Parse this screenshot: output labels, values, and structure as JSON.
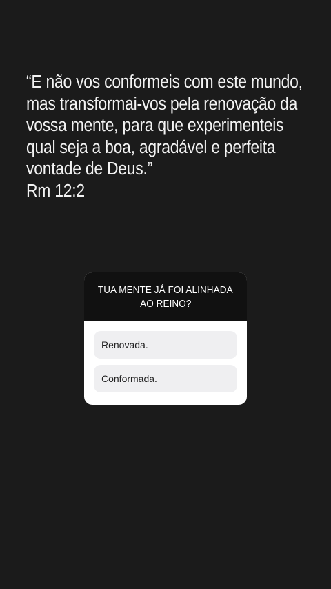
{
  "story": {
    "quote_lines": [
      "“E não vos conformeis com este mundo,",
      "mas transformai-vos pela renovação da",
      "vossa mente, para que experimenteis",
      "qual seja a boa, agradável e perfeita",
      "vontade de Deus.”"
    ],
    "reference": "Rm 12:2"
  },
  "poll": {
    "question_lines": [
      "TUA MENTE JÁ FOI ALINHADA",
      "AO REINO?"
    ],
    "options": [
      "Renovada.",
      "Conformada."
    ]
  },
  "colors": {
    "background": "#1b1b1b",
    "text": "#f2f2f2",
    "poll_header": "#111111",
    "poll_body": "#ffffff",
    "option_bg": "#efeff1"
  }
}
